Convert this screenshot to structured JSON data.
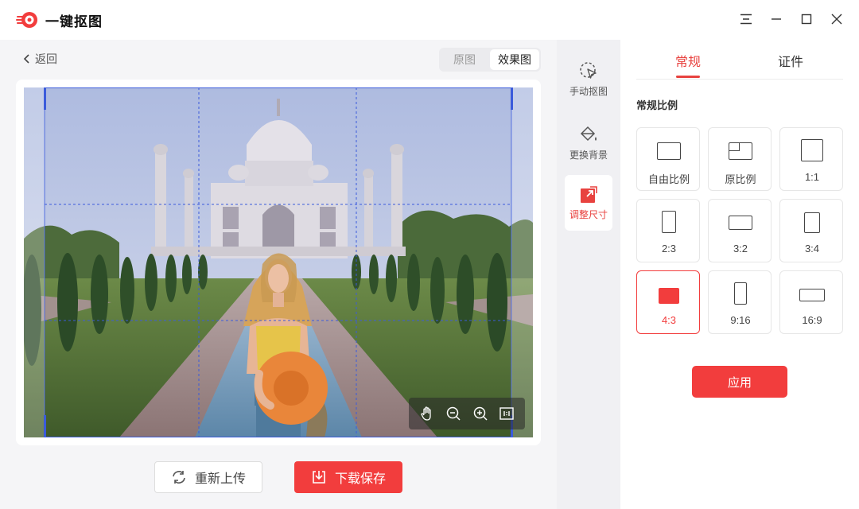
{
  "app": {
    "title": "一键抠图",
    "brand_color": "#f23d3d"
  },
  "window_controls": [
    "menu-icon",
    "minimize-icon",
    "maximize-icon",
    "close-icon"
  ],
  "nav": {
    "back_label": "返回"
  },
  "view_toggle": {
    "original": "原图",
    "result": "效果图",
    "selected": "效果图"
  },
  "image_tools": [
    "hand-icon",
    "zoom-out-icon",
    "zoom-in-icon",
    "actual-size-icon"
  ],
  "actions": {
    "reupload_label": "重新上传",
    "download_label": "下载保存"
  },
  "tools": [
    {
      "label": "手动抠图",
      "icon": "cursor-select-icon",
      "active": false
    },
    {
      "label": "更换背景",
      "icon": "paint-bucket-icon",
      "active": false
    },
    {
      "label": "调整尺寸",
      "icon": "resize-icon",
      "active": true
    }
  ],
  "tabs": [
    {
      "label": "常规",
      "active": true
    },
    {
      "label": "证件",
      "active": false
    }
  ],
  "section_title": "常规比例",
  "ratios": [
    {
      "label": "自由比例",
      "selected": false
    },
    {
      "label": "原比例",
      "selected": false
    },
    {
      "label": "1:1",
      "selected": false
    },
    {
      "label": "2:3",
      "selected": false
    },
    {
      "label": "3:2",
      "selected": false
    },
    {
      "label": "3:4",
      "selected": false
    },
    {
      "label": "4:3",
      "selected": true
    },
    {
      "label": "9:16",
      "selected": false
    },
    {
      "label": "16:9",
      "selected": false
    }
  ],
  "apply_label": "应用"
}
